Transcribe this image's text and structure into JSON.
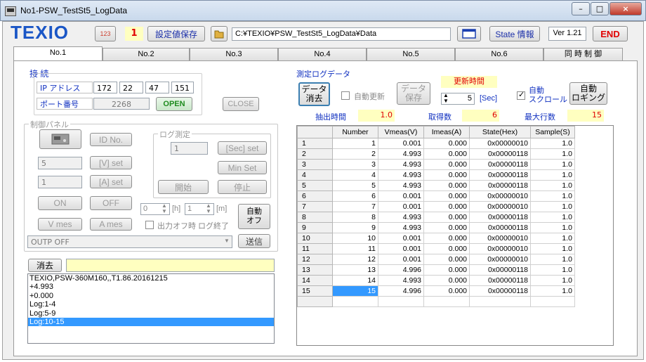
{
  "window": {
    "title": "No1-PSW_TestSt5_LogData",
    "min_label": "–",
    "max_label": "□",
    "close_label": "×"
  },
  "toolbar": {
    "logo": "TEXIO",
    "number_icon": "123",
    "channel": "1",
    "save_settings": "設定値保存",
    "path": "C:¥TEXIO¥PSW_TestSt5_LogData¥Data",
    "state_info": "State 情報",
    "version": "Ver 1.21",
    "end": "END"
  },
  "tabs": [
    "No.1",
    "No.2",
    "No.3",
    "No.4",
    "No.5",
    "No.6",
    "同 時 制 御"
  ],
  "connection": {
    "title": "接 続",
    "ip_label": "IP アドレス",
    "ip": [
      "172",
      "22",
      "47",
      "151"
    ],
    "port_label": "ポート番号",
    "port": "2268",
    "open": "OPEN",
    "close": "CLOSE"
  },
  "control": {
    "title": "制御パネル",
    "id_btn": "ID No.",
    "voltage": "5",
    "v_set": "[V] set",
    "current": "1",
    "a_set": "[A] set",
    "on": "ON",
    "off": "OFF",
    "v_mes": "V mes",
    "a_mes": "A mes",
    "command": "OUTP OFF",
    "send": "送信",
    "log_title": "ログ測定",
    "log_sec": "1",
    "sec_set": "[Sec] set",
    "min_set": "Min Set",
    "start": "開始",
    "stop": "停止",
    "hours": "0",
    "h_unit": "[h]",
    "minutes": "1",
    "m_unit": "[m]",
    "auto_off_line1": "自動",
    "auto_off_line2": "オフ",
    "out_off_label": "出力オフ時 ログ終了"
  },
  "log": {
    "clear": "消去",
    "input": "",
    "lines": [
      "TEXIO,PSW-360M160,,T1.86.20161215",
      "+4.993",
      "+0.000",
      "Log:1-4",
      "Log:5-9",
      "Log:10-15"
    ],
    "selected_index": 5
  },
  "measure": {
    "title": "測定ログデータ",
    "clear_line1": "データ",
    "clear_line2": "消去",
    "auto_update": "自動更新",
    "save_line1": "データ",
    "save_line2": "保存",
    "update_time_label": "更新時間",
    "interval": "5",
    "interval_unit": "[Sec]",
    "auto_scroll_line1": "自動",
    "auto_scroll_line2": "スクロール",
    "auto_log_line1": "自動",
    "auto_log_line2": "ロギング",
    "extract_label": "抽出時間",
    "extract_value": "1.0",
    "count_label": "取得数",
    "count_value": "6",
    "max_rows_label": "最大行数",
    "max_rows_value": "15"
  },
  "table": {
    "columns": [
      "Number",
      "Vmeas(V)",
      "Imeas(A)",
      "State(Hex)",
      "Sample(S)"
    ],
    "rows": [
      [
        "1",
        "1",
        "0.001",
        "0.000",
        "0x00000010",
        "1.0"
      ],
      [
        "2",
        "2",
        "4.993",
        "0.000",
        "0x00000118",
        "1.0"
      ],
      [
        "3",
        "3",
        "4.993",
        "0.000",
        "0x00000118",
        "1.0"
      ],
      [
        "4",
        "4",
        "4.993",
        "0.000",
        "0x00000118",
        "1.0"
      ],
      [
        "5",
        "5",
        "4.993",
        "0.000",
        "0x00000118",
        "1.0"
      ],
      [
        "6",
        "6",
        "0.001",
        "0.000",
        "0x00000010",
        "1.0"
      ],
      [
        "7",
        "7",
        "0.001",
        "0.000",
        "0x00000010",
        "1.0"
      ],
      [
        "8",
        "8",
        "4.993",
        "0.000",
        "0x00000118",
        "1.0"
      ],
      [
        "9",
        "9",
        "4.993",
        "0.000",
        "0x00000118",
        "1.0"
      ],
      [
        "10",
        "10",
        "0.001",
        "0.000",
        "0x00000010",
        "1.0"
      ],
      [
        "11",
        "11",
        "0.001",
        "0.000",
        "0x00000010",
        "1.0"
      ],
      [
        "12",
        "12",
        "0.001",
        "0.000",
        "0x00000010",
        "1.0"
      ],
      [
        "13",
        "13",
        "4.996",
        "0.000",
        "0x00000118",
        "1.0"
      ],
      [
        "14",
        "14",
        "4.993",
        "0.000",
        "0x00000118",
        "1.0"
      ],
      [
        "15",
        "15",
        "4.996",
        "0.000",
        "0x00000118",
        "1.0"
      ]
    ],
    "selected_row": 14
  }
}
